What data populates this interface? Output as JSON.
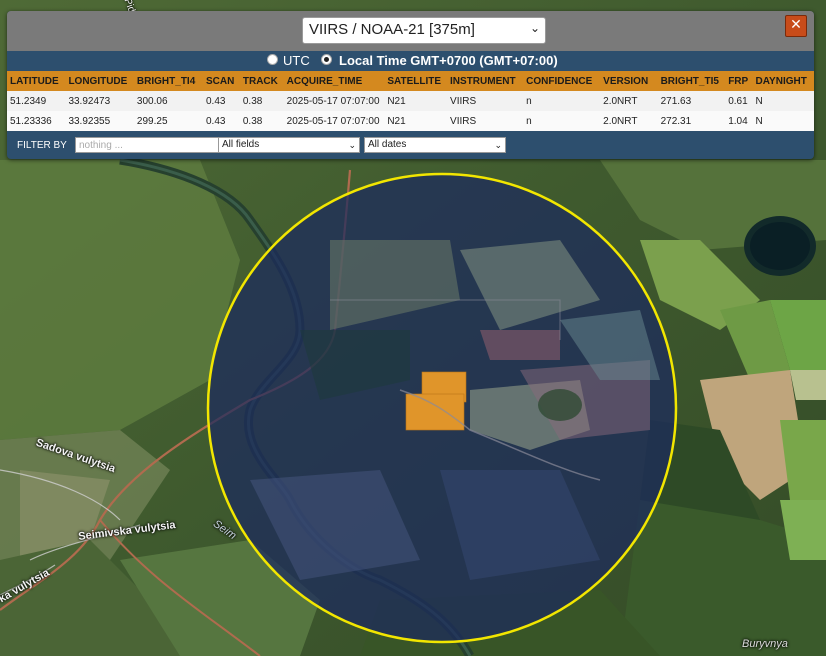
{
  "panel": {
    "product": "VIIRS / NOAA-21 [375m]",
    "close_glyph": "✕",
    "time_options": [
      {
        "label": "UTC",
        "selected": false
      },
      {
        "label": "Local Time GMT+0700 (GMT+07:00)",
        "selected": true
      }
    ],
    "columns": [
      "LATITUDE",
      "LONGITUDE",
      "BRIGHT_TI4",
      "SCAN",
      "TRACK",
      "ACQUIRE_TIME",
      "SATELLITE",
      "INSTRUMENT",
      "CONFIDENCE",
      "VERSION",
      "BRIGHT_TI5",
      "FRP",
      "DAYNIGHT"
    ],
    "rows": [
      [
        "51.2349",
        "33.92473",
        "300.06",
        "0.43",
        "0.38",
        "2025-05-17 07:07:00",
        "N21",
        "VIIRS",
        "n",
        "2.0NRT",
        "271.63",
        "0.61",
        "N"
      ],
      [
        "51.23336",
        "33.92355",
        "299.25",
        "0.43",
        "0.38",
        "2025-05-17 07:07:00",
        "N21",
        "VIIRS",
        "n",
        "2.0NRT",
        "272.31",
        "1.04",
        "N"
      ]
    ],
    "filter": {
      "label": "FILTER BY",
      "placeholder": "nothing ...",
      "field_select": "All fields",
      "date_select": "All dates"
    }
  },
  "map_labels": {
    "street1": "Sadova vulytsia",
    "street2": "Seimivska vulytsia",
    "street3": "ka vulytsia",
    "river": "Seim",
    "town": "Buryvnya",
    "top": "Pid"
  },
  "colors": {
    "highlight_circle": "#f2e600",
    "fire_marker": "#e0952a",
    "table_header": "#d4891f",
    "panel_bg": "#2d4f6e"
  }
}
